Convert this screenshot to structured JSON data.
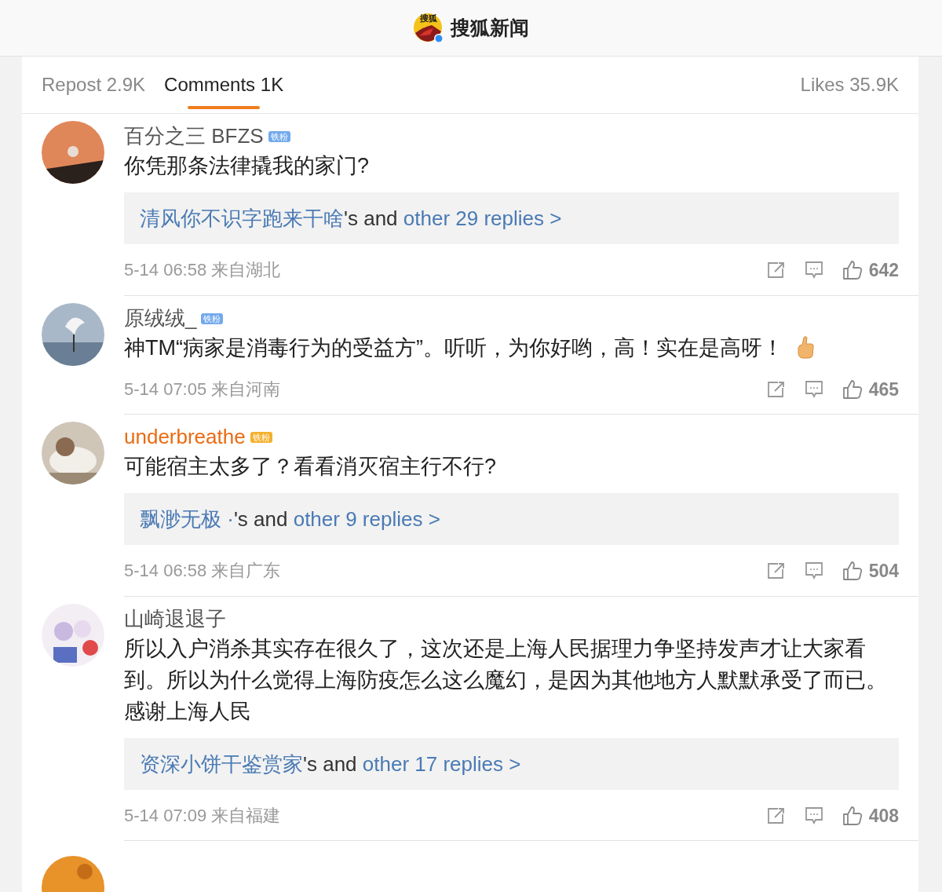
{
  "header": {
    "logo_text": "搜狐",
    "title": "搜狐新闻"
  },
  "tabs": [
    {
      "label": "Repost 2.9K",
      "selected": false
    },
    {
      "label": "Comments 1K",
      "selected": true
    },
    {
      "label": "Likes 35.9K",
      "selected": false
    }
  ],
  "comments": [
    {
      "kind": "comment",
      "name": "百分之三 BFZS",
      "vip": false,
      "badge": "铁粉",
      "text": "你凭那条法律撬我的家门?",
      "has_emoji": false,
      "replies": {
        "author": "清风你不识字跑来干啥",
        "joiner": "'s and",
        "more": "other 29 replies >"
      },
      "time": "5-14 06:58 来自湖北",
      "likes": "642"
    },
    {
      "kind": "comment",
      "name": "原绒绒_",
      "vip": false,
      "badge": "铁粉",
      "text": "神TM“病家是消毒行为的受益方”。听听，为你好哟，高！实在是高呀！",
      "has_emoji": true,
      "time": "5-14 07:05 来自河南",
      "likes": "465"
    },
    {
      "kind": "comment",
      "name": "underbreathe",
      "vip": true,
      "badge": "铁粉",
      "text": "可能宿主太多了？看看消灭宿主行不行?",
      "has_emoji": false,
      "replies": {
        "author": "飘渺无极 ·",
        "joiner": "'s and",
        "more": "other 9 replies >"
      },
      "time": "5-14 06:58 来自广东",
      "likes": "504"
    },
    {
      "kind": "comment",
      "name": "山崎退退子",
      "vip": false,
      "text": "所以入户消杀其实存在很久了，这次还是上海人民据理力争坚持发声才让大家看到。所以为什么觉得上海防疫怎么这么魔幻，是因为其他地方人默默承受了而已。感谢上海人民",
      "has_emoji": false,
      "replies": {
        "author": "资深小饼干鉴赏家",
        "joiner": "'s and",
        "more": "other 17 replies >"
      },
      "time": "5-14 07:09 来自福建",
      "likes": "408"
    },
    {
      "kind": "picture"
    }
  ]
}
